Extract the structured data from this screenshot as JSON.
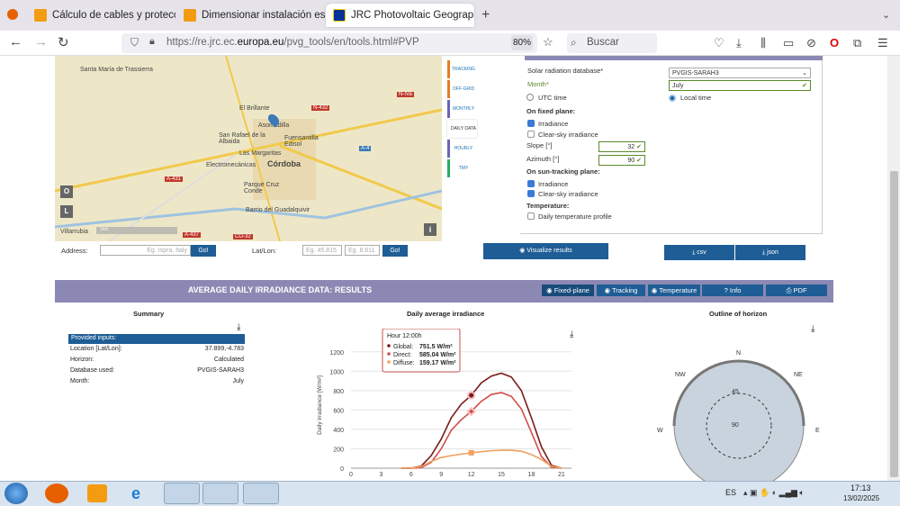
{
  "tabs": [
    {
      "title": "Cálculo de cables y proteccione",
      "icon": "orange-document-icon",
      "active": false
    },
    {
      "title": "Dimensionar instalación este or",
      "icon": "orange-document-icon",
      "active": false
    },
    {
      "title": "JRC Photovoltaic Geographical",
      "icon": "eu-flag-icon",
      "active": true
    }
  ],
  "nav": {
    "url_prefix": "https://re.jrc.ec.",
    "url_domain": "europa.eu",
    "url_suffix": "/pvg_tools/en/tools.html#PVP",
    "zoom": "80%",
    "search_placeholder": "Buscar"
  },
  "map": {
    "places": [
      "Santa María de Trassierra",
      "El Brillante",
      "Asomadilla",
      "San Rafael de la Albaida",
      "Fuensantilla Edisol",
      "Las Margaritas",
      "Electromecánicas",
      "Córdoba",
      "Parque Cruz Conde",
      "Barrio del Guadalquivir",
      "Villarrubia"
    ],
    "roads": [
      "N-432",
      "N-IVa",
      "A-4",
      "A-431",
      "A-437",
      "CO-32"
    ],
    "toggles": [
      "O",
      "L"
    ],
    "scale": "1km"
  },
  "address": {
    "label": "Address:",
    "placeholder": "Eg. Ispra, Italy",
    "go": "Go!",
    "latlon_label": "Lat/Lon:",
    "lat_placeholder": "Eg. 45.815",
    "lon_placeholder": "Eg. 8.611"
  },
  "sidetabs": [
    {
      "label": "TRACKING PV",
      "color": "#e67e22"
    },
    {
      "label": "OFF-GRID",
      "color": "#e67e22"
    },
    {
      "label": "MONTHLY DATA",
      "color": "#6c63b5"
    },
    {
      "label": "DAILY DATA",
      "color": "#6c63b5"
    },
    {
      "label": "HOURLY DATA",
      "color": "#6c63b5"
    },
    {
      "label": "TMY",
      "color": "#27ae60"
    }
  ],
  "form": {
    "db_label": "Solar radiation database*",
    "db_value": "PVGIS-SARAH3",
    "month_label": "Month*",
    "month_value": "July",
    "utc_label": "UTC time",
    "local_label": "Local time",
    "fixed_title": "On fixed plane:",
    "fixed_irr": "Irradiance",
    "fixed_clear": "Clear-sky irradiance",
    "slope_label": "Slope [°]",
    "slope_value": "32",
    "azimuth_label": "Azimuth [°]",
    "azimuth_value": "90",
    "track_title": "On sun-tracking plane:",
    "track_irr": "Irradiance",
    "track_clear": "Clear-sky irradiance",
    "temp_title": "Temperature:",
    "temp_profile": "Daily temperature profile",
    "visualize": "Visualize results",
    "csv": "csv",
    "json": "json"
  },
  "results": {
    "title": "AVERAGE DAILY IRRADIANCE DATA: RESULTS",
    "buttons": [
      "Fixed-plane",
      "Tracking",
      "Temperature",
      "Info",
      "PDF"
    ]
  },
  "summary": {
    "title": "Summary",
    "header": "Provided inputs:",
    "rows": [
      {
        "k": "Location [Lat/Lon]:",
        "v": "37.899,-4.783"
      },
      {
        "k": "Horizon:",
        "v": "Calculated"
      },
      {
        "k": "Database used:",
        "v": "PVGIS-SARAH3"
      },
      {
        "k": "Month:",
        "v": "July"
      }
    ]
  },
  "chart_data": {
    "type": "line",
    "title": "Daily average irradiance",
    "ylabel": "Daily irradiance [W/m²]",
    "x": [
      5,
      6,
      7,
      8,
      9,
      10,
      11,
      12,
      13,
      14,
      15,
      16,
      17,
      18,
      19,
      20,
      21
    ],
    "xticks": [
      0,
      3,
      6,
      9,
      12,
      15,
      18,
      21
    ],
    "yticks": [
      0,
      200,
      400,
      600,
      800,
      1000,
      1200
    ],
    "ylim": [
      0,
      1300
    ],
    "series": [
      {
        "name": "Global",
        "color": "#7a1a1a",
        "values": [
          0,
          0,
          20,
          130,
          300,
          520,
          660,
          751.5,
          880,
          950,
          980,
          940,
          800,
          520,
          220,
          30,
          0
        ]
      },
      {
        "name": "Direct",
        "color": "#d24b4b",
        "values": [
          0,
          0,
          5,
          60,
          200,
          390,
          500,
          585.04,
          690,
          760,
          780,
          740,
          610,
          370,
          120,
          10,
          0
        ]
      },
      {
        "name": "Diffuse",
        "color": "#f0a060",
        "values": [
          0,
          0,
          15,
          70,
          110,
          130,
          145,
          159.17,
          170,
          180,
          185,
          185,
          175,
          140,
          90,
          20,
          0
        ]
      }
    ],
    "tooltip": {
      "title": "Hour 12:00h",
      "lines": [
        {
          "label": "Global:",
          "value": "751.5 W/m²"
        },
        {
          "label": "Direct:",
          "value": "585.04 W/m²"
        },
        {
          "label": "Diffuse:",
          "value": "159.17 W/m²"
        }
      ]
    }
  },
  "horizon": {
    "title": "Outline of horizon",
    "labels": [
      "N",
      "NE",
      "NW",
      "W",
      "E",
      "45",
      "90"
    ]
  },
  "taskbar": {
    "lang": "ES",
    "time": "17:13",
    "date": "13/02/2025"
  }
}
